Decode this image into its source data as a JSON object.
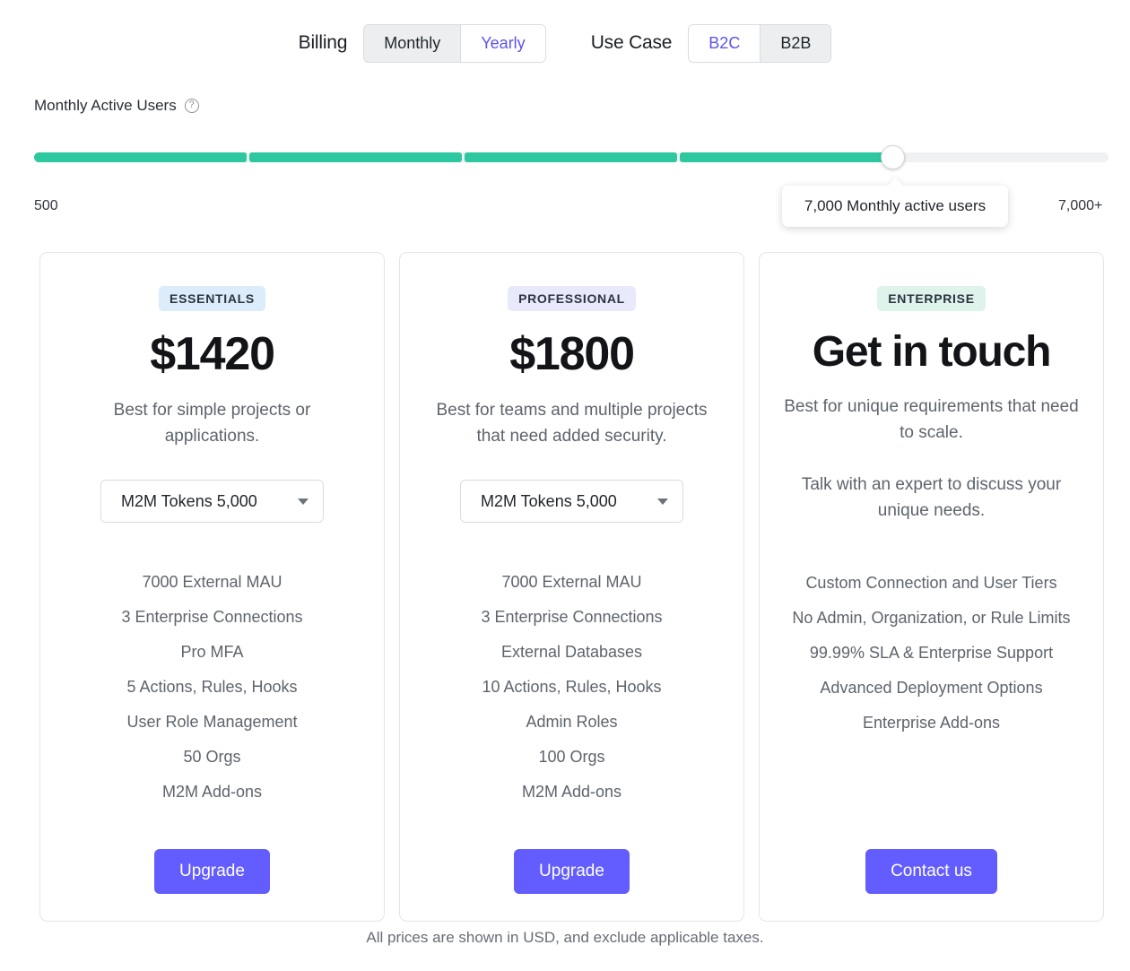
{
  "controls": {
    "billing": {
      "label": "Billing",
      "options": [
        "Monthly",
        "Yearly"
      ],
      "selected": "Monthly"
    },
    "use_case": {
      "label": "Use Case",
      "options": [
        "B2C",
        "B2B"
      ],
      "selected": "B2B"
    }
  },
  "slider": {
    "label": "Monthly Active Users",
    "help_icon": "question-circle-icon",
    "min_label": "500",
    "max_label": "7,000+",
    "tooltip": "7,000 Monthly active users",
    "value": 7000,
    "fill_color": "#2dc8a0",
    "track_color": "#f0f1f2",
    "segments_filled": 4,
    "segments_total": 5
  },
  "plans": [
    {
      "badge": "ESSENTIALS",
      "badge_color": "#dcecfb",
      "price": "$1420",
      "description": "Best for simple projects or applications.",
      "select": {
        "value": "M2M Tokens 5,000",
        "icon": "chevron-down-icon"
      },
      "features": [
        "7000 External MAU",
        "3 Enterprise Connections",
        "Pro MFA",
        "5 Actions, Rules, Hooks",
        "User Role Management",
        "50 Orgs",
        "M2M Add-ons"
      ],
      "cta": "Upgrade"
    },
    {
      "badge": "PROFESSIONAL",
      "badge_color": "#e8eafb",
      "price": "$1800",
      "description": "Best for teams and multiple projects that need added security.",
      "select": {
        "value": "M2M Tokens 5,000",
        "icon": "chevron-down-icon"
      },
      "features": [
        "7000 External MAU",
        "3 Enterprise Connections",
        "External Databases",
        "10 Actions, Rules, Hooks",
        "Admin Roles",
        "100 Orgs",
        "M2M Add-ons"
      ],
      "cta": "Upgrade"
    },
    {
      "badge": "ENTERPRISE",
      "badge_color": "#def3ea",
      "price": "Get in touch",
      "description": "Best for unique requirements that need to scale.",
      "description2": "Talk with an expert to discuss your unique needs.",
      "features": [
        "Custom Connection and User Tiers",
        "No Admin, Organization, or Rule Limits",
        "99.99% SLA & Enterprise Support",
        "Advanced Deployment Options",
        "Enterprise Add-ons"
      ],
      "cta": "Contact us"
    }
  ],
  "footnote": "All prices are shown in USD, and exclude applicable taxes.",
  "accent_color": "#635dff"
}
